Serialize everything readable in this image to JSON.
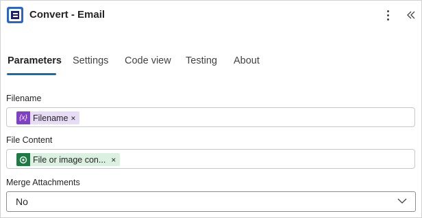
{
  "header": {
    "title": "Convert - Email",
    "app_icon": "plumsail-logo-icon",
    "menu_icon": "more-vertical-icon",
    "collapse_icon": "double-chevron-left-icon"
  },
  "tabs": [
    {
      "label": "Parameters",
      "active": true
    },
    {
      "label": "Settings",
      "active": false
    },
    {
      "label": "Code view",
      "active": false
    },
    {
      "label": "Testing",
      "active": false
    },
    {
      "label": "About",
      "active": false
    }
  ],
  "fields": {
    "filename": {
      "label": "Filename",
      "token": {
        "icon_text": "{x}",
        "text": "Filename",
        "remove": "×",
        "kind": "variable"
      }
    },
    "file_content": {
      "label": "File Content",
      "token": {
        "icon_text": "",
        "text": "File or image con...",
        "remove": "×",
        "kind": "output"
      }
    },
    "merge_attachments": {
      "label": "Merge Attachments",
      "value": "No"
    }
  },
  "colors": {
    "accent": "#0f6cbd",
    "variable_token_bg": "#e7dcf5",
    "variable_token_icon": "#7f40c7",
    "output_token_bg": "#dcf0e2",
    "output_token_icon": "#1d7a43"
  }
}
